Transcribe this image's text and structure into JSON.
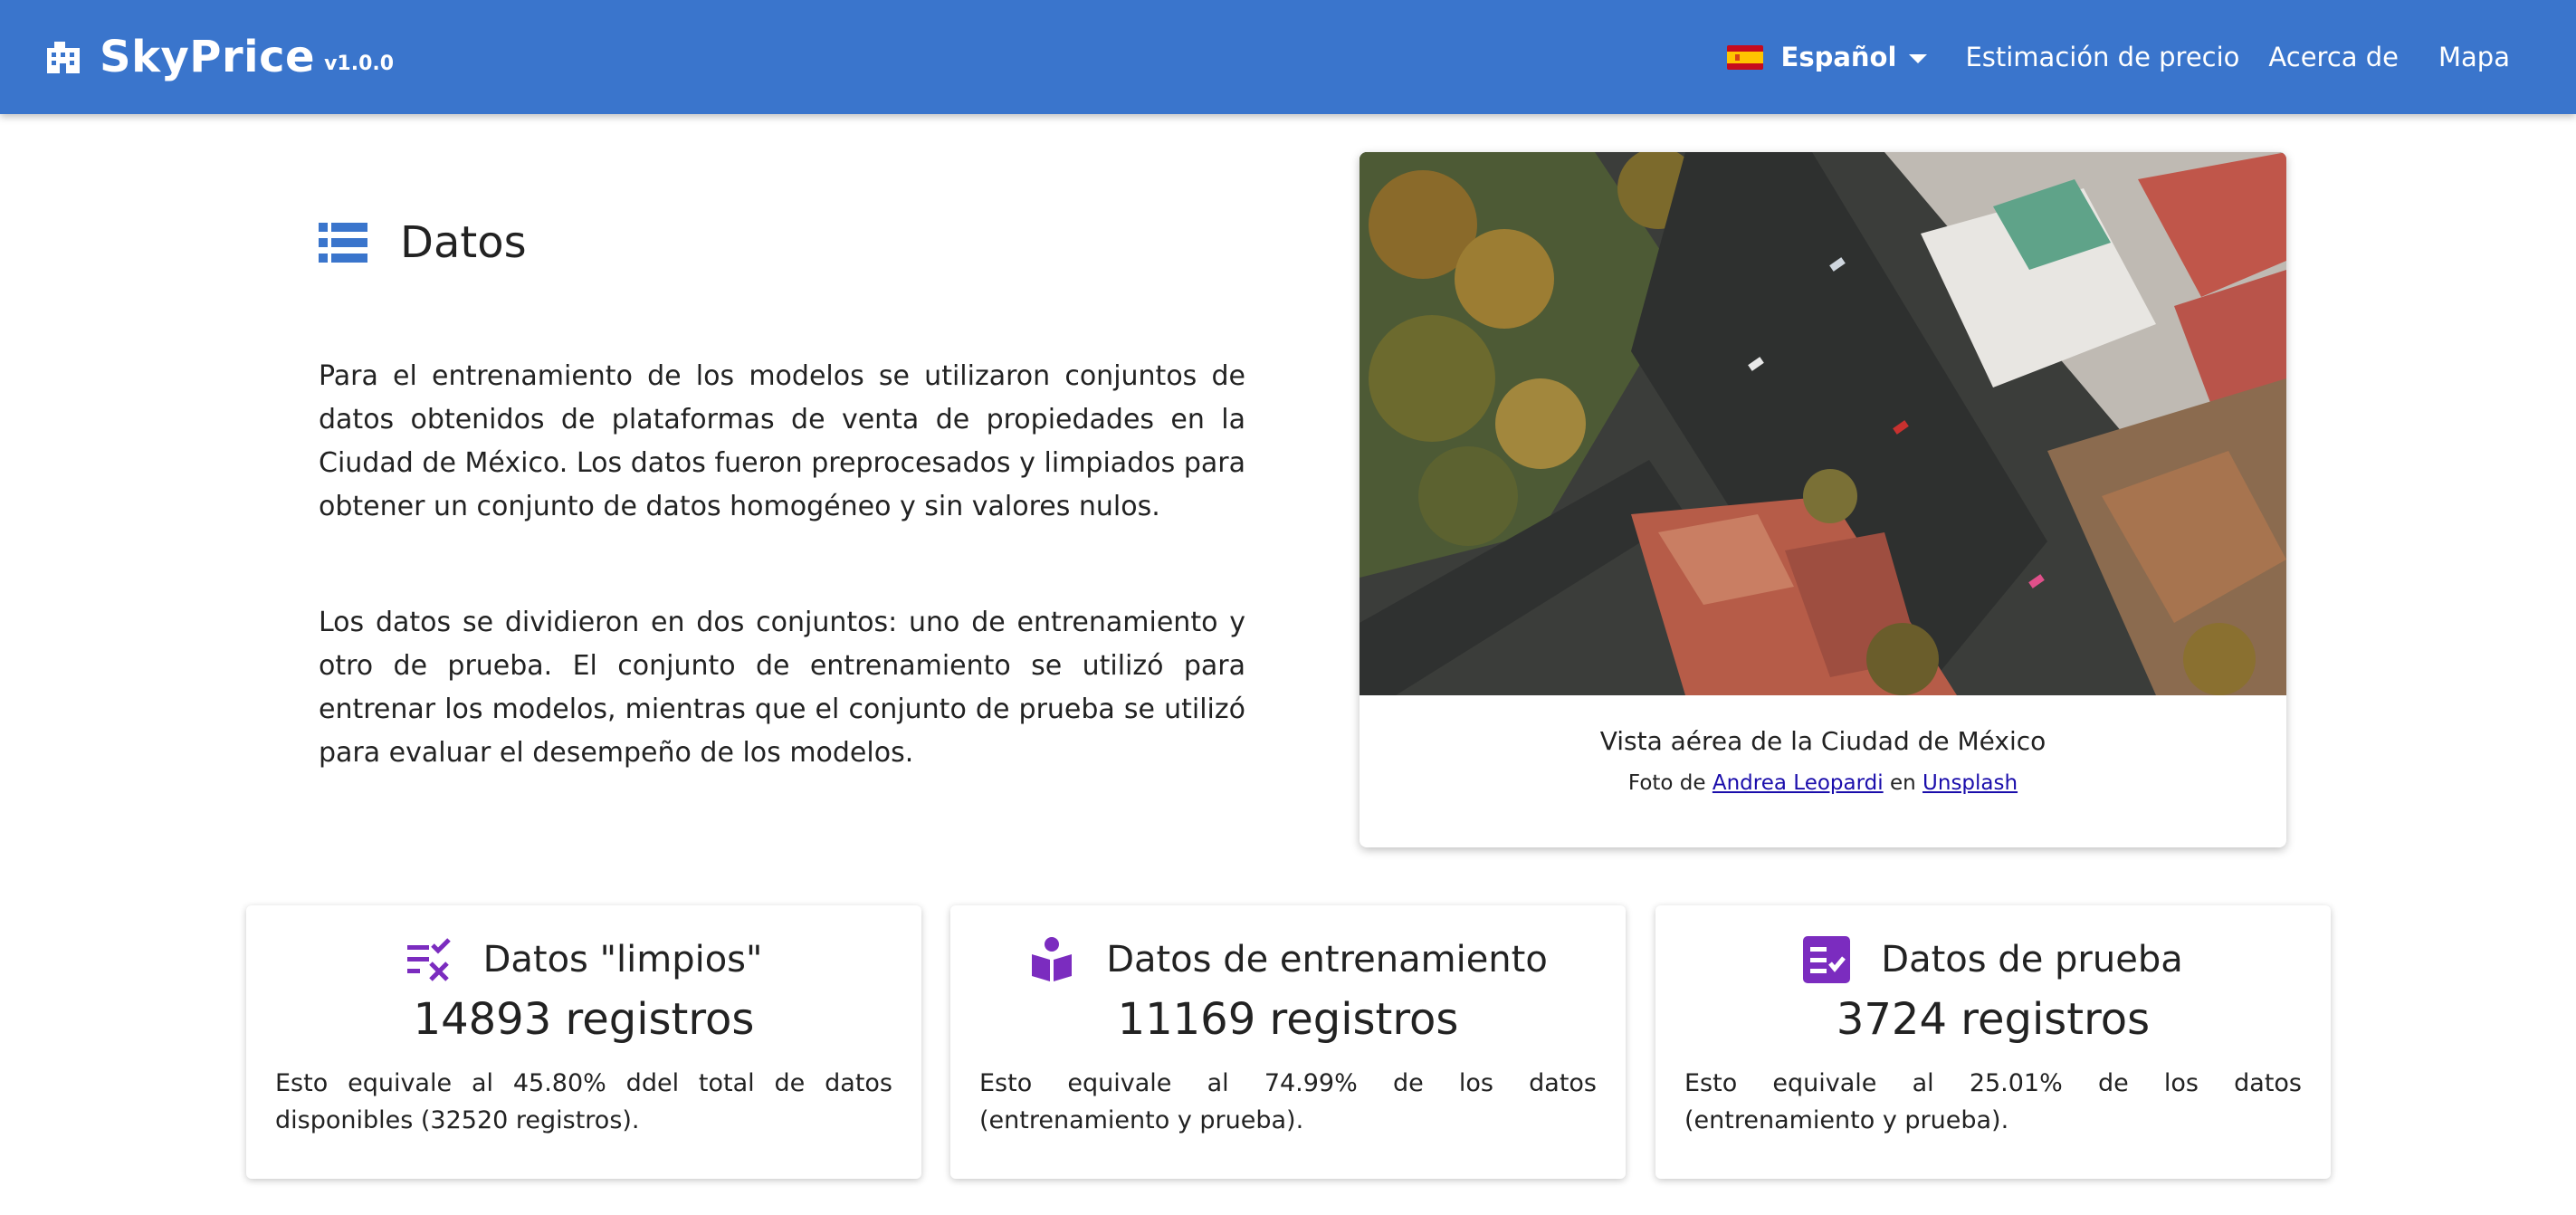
{
  "navbar": {
    "brand_name": "SkyPrice",
    "version": "v1.0.0",
    "language_label": "Español",
    "links": [
      "Estimación de precio",
      "Acerca de",
      "Mapa"
    ],
    "color": "#3a75cc",
    "icons": {
      "brand": "building-icon",
      "flag": "spain-flag-icon",
      "caret": "chevron-down-icon"
    }
  },
  "section": {
    "title": "Datos",
    "icon": "list-icon",
    "paragraphs": [
      "Para el entrenamiento de los modelos se utilizaron conjuntos de datos obtenidos de plataformas de venta de propiedades en la Ciudad de México. Los datos fueron preprocesados y limpiados para obtener un conjunto de datos homogéneo y sin valores nulos.",
      "Los datos se dividieron en dos conjuntos: uno de entrenamiento y otro de prueba. El conjunto de entrenamiento se utilizó para entrenar los modelos, mientras que el conjunto de prueba se utilizó para evaluar el desempeño de los modelos."
    ]
  },
  "photo": {
    "caption": "Vista aérea de la Ciudad de México",
    "credit_prefix": "Foto de",
    "author": "Andrea Leopardi",
    "credit_middle": "en",
    "source": "Unsplash"
  },
  "stats": [
    {
      "icon": "clear-list-icon",
      "title": "Datos \"limpios\"",
      "value": "14893 registros",
      "description": "Esto equivale al 45.80% ddel total de datos disponibles (32520 registros)."
    },
    {
      "icon": "book-reader-icon",
      "title": "Datos de entrenamiento",
      "value": "11169 registros",
      "description": "Esto equivale al 74.99% de los datos (entrenamiento y prueba)."
    },
    {
      "icon": "checklist-icon",
      "title": "Datos de prueba",
      "value": "3724 registros",
      "description": "Esto equivale al 25.01% de los datos (entrenamiento y prueba)."
    }
  ],
  "accent_color": "#7b2cbf"
}
